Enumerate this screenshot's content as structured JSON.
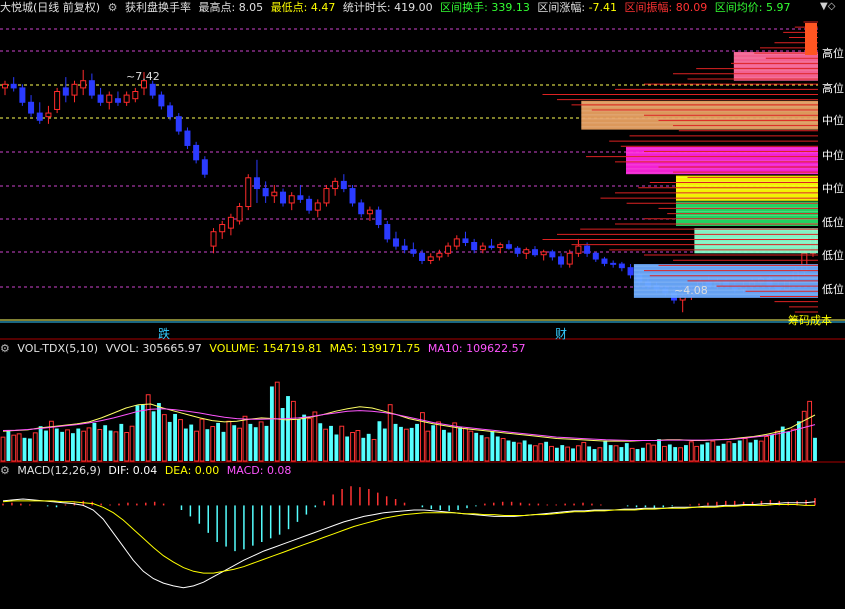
{
  "main_header": {
    "stock": "大悦城(日线 前复权)",
    "indicator": "获利盘换手率",
    "high_label": "最高点:",
    "high_value": "8.05",
    "low_label": "最低点:",
    "low_value": "4.47",
    "span_label": "统计时长:",
    "span_value": "419.00",
    "turnover_label": "区间换手:",
    "turnover_value": "339.13",
    "change_label": "区间涨幅:",
    "change_value": "-7.41",
    "amp_label": "区间振幅:",
    "amp_value": "80.09",
    "avg_label": "区间均价:",
    "avg_value": "5.97"
  },
  "vol_header": {
    "name": "VOL-TDX(5,10)",
    "vvol": "VVOL: 305665.97",
    "volume": "VOLUME: 154719.81",
    "ma5": "MA5: 139171.75",
    "ma10": "MA10: 109622.57"
  },
  "macd_header": {
    "name": "MACD(12,26,9)",
    "dif": "DIF: 0.04",
    "dea": "DEA: 0.00",
    "macd": "MACD: 0.08"
  },
  "annotations": {
    "high_mark": "7.42",
    "low_mark": "4.08",
    "event_1": "跌",
    "event_2": "财",
    "bottom_right": "筹码成本"
  },
  "zone_labels": [
    "高位",
    "高位",
    "中位",
    "中位",
    "中位",
    "低位",
    "低位",
    "低位"
  ],
  "chart_data": [
    {
      "type": "candlestick",
      "title": "大悦城(日线 前复权)",
      "ylim": [
        4.0,
        8.2
      ],
      "annotated_high": 7.42,
      "annotated_low": 4.08,
      "candles": [
        [
          7.2,
          7.3,
          7.1,
          7.25
        ],
        [
          7.25,
          7.35,
          7.15,
          7.2
        ],
        [
          7.2,
          7.25,
          6.95,
          7.0
        ],
        [
          7.0,
          7.1,
          6.8,
          6.85
        ],
        [
          6.85,
          7.0,
          6.7,
          6.75
        ],
        [
          6.8,
          6.95,
          6.7,
          6.85
        ],
        [
          6.9,
          7.2,
          6.85,
          7.15
        ],
        [
          7.2,
          7.35,
          7.0,
          7.1
        ],
        [
          7.1,
          7.3,
          7.0,
          7.25
        ],
        [
          7.2,
          7.45,
          7.1,
          7.3
        ],
        [
          7.3,
          7.4,
          7.05,
          7.1
        ],
        [
          7.1,
          7.2,
          6.95,
          7.0
        ],
        [
          7.0,
          7.15,
          6.9,
          7.1
        ],
        [
          7.05,
          7.15,
          6.95,
          7.0
        ],
        [
          7.0,
          7.15,
          6.95,
          7.1
        ],
        [
          7.05,
          7.2,
          7.0,
          7.15
        ],
        [
          7.2,
          7.42,
          7.1,
          7.3
        ],
        [
          7.25,
          7.3,
          7.05,
          7.1
        ],
        [
          7.1,
          7.15,
          6.9,
          6.95
        ],
        [
          6.95,
          7.0,
          6.75,
          6.8
        ],
        [
          6.8,
          6.85,
          6.55,
          6.6
        ],
        [
          6.6,
          6.65,
          6.35,
          6.4
        ],
        [
          6.4,
          6.45,
          6.15,
          6.2
        ],
        [
          6.2,
          6.25,
          5.95,
          6.0
        ],
        [
          5.0,
          5.25,
          4.9,
          5.2
        ],
        [
          5.2,
          5.35,
          5.1,
          5.3
        ],
        [
          5.25,
          5.45,
          5.15,
          5.4
        ],
        [
          5.35,
          5.6,
          5.3,
          5.55
        ],
        [
          5.55,
          6.0,
          5.5,
          5.95
        ],
        [
          5.95,
          6.2,
          5.6,
          5.8
        ],
        [
          5.8,
          5.9,
          5.6,
          5.7
        ],
        [
          5.7,
          5.85,
          5.6,
          5.75
        ],
        [
          5.75,
          5.8,
          5.55,
          5.6
        ],
        [
          5.6,
          5.75,
          5.5,
          5.7
        ],
        [
          5.7,
          5.85,
          5.6,
          5.65
        ],
        [
          5.65,
          5.7,
          5.45,
          5.5
        ],
        [
          5.5,
          5.65,
          5.4,
          5.6
        ],
        [
          5.6,
          5.85,
          5.55,
          5.8
        ],
        [
          5.8,
          5.95,
          5.7,
          5.9
        ],
        [
          5.9,
          6.0,
          5.75,
          5.8
        ],
        [
          5.8,
          5.85,
          5.55,
          5.6
        ],
        [
          5.6,
          5.65,
          5.4,
          5.45
        ],
        [
          5.45,
          5.55,
          5.35,
          5.5
        ],
        [
          5.5,
          5.55,
          5.25,
          5.3
        ],
        [
          5.3,
          5.35,
          5.05,
          5.1
        ],
        [
          5.1,
          5.2,
          4.95,
          5.0
        ],
        [
          5.0,
          5.1,
          4.9,
          4.95
        ],
        [
          4.95,
          5.05,
          4.85,
          4.9
        ],
        [
          4.9,
          4.95,
          4.75,
          4.8
        ],
        [
          4.8,
          4.9,
          4.75,
          4.85
        ],
        [
          4.85,
          4.95,
          4.8,
          4.9
        ],
        [
          4.9,
          5.05,
          4.85,
          5.0
        ],
        [
          5.0,
          5.15,
          4.95,
          5.1
        ],
        [
          5.1,
          5.2,
          5.0,
          5.05
        ],
        [
          5.05,
          5.1,
          4.9,
          4.95
        ],
        [
          4.95,
          5.05,
          4.9,
          5.0
        ],
        [
          5.0,
          5.1,
          4.95,
          4.98
        ],
        [
          4.98,
          5.05,
          4.9,
          5.02
        ],
        [
          5.02,
          5.08,
          4.95,
          4.97
        ],
        [
          4.97,
          5.0,
          4.85,
          4.9
        ],
        [
          4.9,
          4.98,
          4.82,
          4.95
        ],
        [
          4.95,
          5.0,
          4.85,
          4.88
        ],
        [
          4.88,
          4.95,
          4.8,
          4.92
        ],
        [
          4.92,
          4.95,
          4.8,
          4.85
        ],
        [
          4.85,
          4.9,
          4.7,
          4.75
        ],
        [
          4.75,
          4.95,
          4.7,
          4.9
        ],
        [
          4.9,
          5.1,
          4.85,
          5.0
        ],
        [
          5.0,
          5.05,
          4.85,
          4.9
        ],
        [
          4.9,
          4.92,
          4.78,
          4.82
        ],
        [
          4.82,
          4.85,
          4.72,
          4.76
        ],
        [
          4.76,
          4.8,
          4.7,
          4.75
        ],
        [
          4.75,
          4.78,
          4.65,
          4.7
        ],
        [
          4.7,
          4.75,
          4.55,
          4.6
        ],
        [
          4.6,
          4.65,
          4.45,
          4.5
        ],
        [
          4.5,
          4.55,
          4.4,
          4.45
        ],
        [
          4.45,
          4.5,
          4.35,
          4.4
        ],
        [
          4.4,
          4.45,
          4.3,
          4.35
        ],
        [
          4.35,
          4.4,
          4.2,
          4.25
        ],
        [
          4.25,
          4.35,
          4.08,
          4.3
        ],
        [
          4.3,
          4.45,
          4.25,
          4.4
        ],
        [
          4.4,
          4.55,
          4.35,
          4.5
        ],
        [
          4.5,
          4.6,
          4.4,
          4.45
        ],
        [
          4.45,
          4.55,
          4.4,
          4.5
        ],
        [
          4.5,
          4.55,
          4.4,
          4.45
        ],
        [
          4.45,
          4.5,
          4.35,
          4.4
        ],
        [
          4.4,
          4.5,
          4.35,
          4.45
        ],
        [
          4.45,
          4.55,
          4.4,
          4.5
        ],
        [
          4.5,
          4.6,
          4.45,
          4.55
        ],
        [
          4.55,
          4.6,
          4.4,
          4.45
        ],
        [
          4.45,
          4.5,
          4.35,
          4.4
        ],
        [
          4.4,
          4.55,
          4.38,
          4.52
        ],
        [
          4.52,
          4.7,
          4.5,
          4.65
        ],
        [
          4.65,
          4.95,
          4.6,
          4.9
        ],
        [
          4.9,
          5.25,
          4.85,
          5.15
        ]
      ]
    },
    {
      "type": "bar",
      "title": "VOL-TDX(5,10)",
      "ylim": [
        0,
        320000
      ],
      "volumes": [
        72000,
        90000,
        78000,
        82000,
        70000,
        68000,
        85000,
        105000,
        92000,
        120000,
        98000,
        88000,
        94000,
        84000,
        98000,
        90000,
        100000,
        115000,
        95000,
        108000,
        92000,
        88000,
        112000,
        86000,
        105000,
        168000,
        170000,
        200000,
        150000,
        175000,
        140000,
        118000,
        142000,
        125000,
        98000,
        110000,
        90000,
        126000,
        96000,
        104000,
        115000,
        88000,
        120000,
        108000,
        99000,
        135000,
        112000,
        102000,
        118000,
        106000,
        225000,
        238000,
        160000,
        196000,
        180000,
        126000,
        140000,
        128000,
        148000,
        114000,
        96000,
        106000,
        80000,
        105000,
        74000,
        86000,
        92000,
        70000,
        82000,
        65000,
        120000,
        98000,
        170000,
        112000,
        103000,
        96000,
        100000,
        112000,
        146000,
        90000,
        108000,
        118000,
        94000,
        86000,
        115000,
        102000,
        98000,
        90000,
        85000,
        78000,
        70000,
        90000,
        74000,
        68000,
        62000,
        58000,
        54000,
        62000,
        50000,
        46000,
        52000,
        58000,
        44000,
        40000,
        48000,
        42000,
        38000,
        46000,
        56000,
        44000,
        36000,
        40000,
        62000,
        48000,
        46000,
        42000,
        54000,
        38000,
        36000,
        40000,
        52000,
        48000,
        66000,
        44000,
        50000,
        42000,
        40000,
        48000,
        58000,
        44000,
        50000,
        56000,
        60000,
        46000,
        52000,
        58000,
        54000,
        62000,
        68000,
        56000,
        64000,
        60000,
        74000,
        80000,
        90000,
        104000,
        88000,
        96000,
        120000,
        150000,
        180000,
        70000
      ],
      "ma5": [
        90000,
        92000,
        94000,
        100000,
        104000,
        108000,
        112000,
        118000,
        130000,
        145000,
        160000,
        170000,
        172000,
        160000,
        150000,
        140000,
        130000,
        122000,
        118000,
        120000,
        126000,
        130000,
        128000,
        124000,
        126000,
        132000,
        140000,
        150000,
        158000,
        164000,
        160000,
        150000,
        140000,
        128000,
        120000,
        112000,
        106000,
        100000,
        96000,
        92000,
        88000,
        84000,
        80000,
        76000,
        72000,
        68000,
        66000,
        64000,
        62000,
        60000,
        60000,
        60000,
        62000,
        62000,
        64000,
        64000,
        62000,
        62000,
        64000,
        66000,
        70000,
        74000,
        80000,
        88000,
        100000,
        120000,
        139000
      ],
      "ma10": [
        92000,
        93000,
        95000,
        98000,
        102000,
        106000,
        110000,
        115000,
        122000,
        130000,
        140000,
        150000,
        156000,
        158000,
        155000,
        150000,
        145000,
        138000,
        132000,
        128000,
        126000,
        126000,
        127000,
        128000,
        130000,
        134000,
        140000,
        145000,
        150000,
        152000,
        150000,
        146000,
        140000,
        132000,
        124000,
        116000,
        110000,
        104000,
        100000,
        96000,
        92000,
        88000,
        84000,
        80000,
        76000,
        72000,
        70000,
        68000,
        66000,
        64000,
        63000,
        62000,
        62000,
        62000,
        63000,
        63000,
        63000,
        63000,
        64000,
        65000,
        68000,
        72000,
        76000,
        82000,
        90000,
        100000,
        110000
      ]
    },
    {
      "type": "bar",
      "title": "MACD(12,26,9)",
      "ylim": [
        -1.1,
        0.3
      ],
      "macd": [
        0.02,
        0.03,
        0.02,
        0.01,
        0.0,
        -0.01,
        -0.02,
        0.01,
        0.03,
        0.05,
        0.04,
        0.02,
        0.01,
        0.02,
        0.03,
        0.02,
        0.03,
        0.04,
        0.02,
        0.0,
        -0.05,
        -0.12,
        -0.2,
        -0.3,
        -0.4,
        -0.45,
        -0.5,
        -0.48,
        -0.44,
        -0.4,
        -0.36,
        -0.32,
        -0.26,
        -0.18,
        -0.1,
        -0.02,
        0.05,
        0.12,
        0.18,
        0.21,
        0.2,
        0.18,
        0.14,
        0.1,
        0.07,
        0.03,
        0.0,
        -0.02,
        -0.04,
        -0.05,
        -0.06,
        -0.05,
        -0.03,
        -0.01,
        0.02,
        0.03,
        0.04,
        0.04,
        0.03,
        0.02,
        0.02,
        0.01,
        0.01,
        0.02,
        0.02,
        0.03,
        0.02,
        0.01,
        0.0,
        0.0,
        -0.01,
        -0.02,
        -0.02,
        -0.03,
        -0.02,
        -0.01,
        0.0,
        0.01,
        0.02,
        0.03,
        0.04,
        0.05,
        0.05,
        0.04,
        0.04,
        0.05,
        0.06,
        0.05,
        0.04,
        0.05,
        0.06,
        0.08
      ],
      "dif": [
        0.05,
        0.06,
        0.07,
        0.06,
        0.05,
        0.04,
        0.03,
        0.02,
        0.0,
        -0.05,
        -0.15,
        -0.3,
        -0.45,
        -0.6,
        -0.72,
        -0.8,
        -0.85,
        -0.88,
        -0.9,
        -0.88,
        -0.84,
        -0.78,
        -0.72,
        -0.66,
        -0.6,
        -0.55,
        -0.5,
        -0.46,
        -0.42,
        -0.38,
        -0.34,
        -0.3,
        -0.26,
        -0.22,
        -0.18,
        -0.15,
        -0.12,
        -0.1,
        -0.08,
        -0.07,
        -0.06,
        -0.05,
        -0.05,
        -0.06,
        -0.07,
        -0.08,
        -0.09,
        -0.1,
        -0.11,
        -0.12,
        -0.12,
        -0.12,
        -0.11,
        -0.1,
        -0.09,
        -0.08,
        -0.07,
        -0.06,
        -0.06,
        -0.05,
        -0.05,
        -0.05,
        -0.04,
        -0.04,
        -0.03,
        -0.03,
        -0.03,
        -0.02,
        -0.02,
        -0.02,
        -0.01,
        -0.01,
        0.0,
        0.0,
        0.01,
        0.01,
        0.02,
        0.02,
        0.03,
        0.03,
        0.03,
        0.04
      ],
      "dea": [
        0.04,
        0.05,
        0.05,
        0.05,
        0.05,
        0.05,
        0.04,
        0.04,
        0.03,
        0.02,
        -0.02,
        -0.08,
        -0.16,
        -0.26,
        -0.36,
        -0.46,
        -0.55,
        -0.62,
        -0.68,
        -0.72,
        -0.74,
        -0.74,
        -0.72,
        -0.7,
        -0.67,
        -0.63,
        -0.59,
        -0.55,
        -0.51,
        -0.47,
        -0.43,
        -0.39,
        -0.35,
        -0.31,
        -0.27,
        -0.23,
        -0.2,
        -0.17,
        -0.14,
        -0.12,
        -0.1,
        -0.09,
        -0.08,
        -0.08,
        -0.08,
        -0.08,
        -0.09,
        -0.09,
        -0.1,
        -0.1,
        -0.11,
        -0.11,
        -0.11,
        -0.1,
        -0.1,
        -0.09,
        -0.08,
        -0.07,
        -0.07,
        -0.06,
        -0.06,
        -0.05,
        -0.05,
        -0.05,
        -0.04,
        -0.04,
        -0.03,
        -0.03,
        -0.03,
        -0.02,
        -0.02,
        -0.02,
        -0.01,
        -0.01,
        0.0,
        0.0,
        0.0,
        0.01,
        0.01,
        0.01,
        0.0,
        0.0
      ]
    }
  ],
  "chip_profile": {
    "zones": [
      {
        "price_top": 7.7,
        "price_bottom": 7.3,
        "width": 0.32,
        "color": "#ff6699"
      },
      {
        "price_top": 7.02,
        "price_bottom": 6.62,
        "width": 0.9,
        "color": "#e8a060"
      },
      {
        "price_top": 6.38,
        "price_bottom": 6.0,
        "width": 0.73,
        "color": "#ff22dd"
      },
      {
        "price_top": 5.98,
        "price_bottom": 5.63,
        "width": 0.54,
        "color": "#ffff00"
      },
      {
        "price_top": 5.62,
        "price_bottom": 5.28,
        "width": 0.54,
        "color": "#22dd66"
      },
      {
        "price_top": 5.25,
        "price_bottom": 4.9,
        "width": 0.47,
        "color": "#88ffcc"
      },
      {
        "price_top": 4.75,
        "price_bottom": 4.28,
        "width": 0.7,
        "color": "#6aaaff"
      }
    ],
    "profile": [
      0.05,
      0.08,
      0.12,
      0.1,
      0.15,
      0.2,
      0.22,
      0.18,
      0.3,
      0.42,
      0.5,
      0.45,
      0.6,
      0.7,
      0.95,
      0.9,
      0.85,
      0.78,
      0.6,
      0.55,
      0.5,
      0.48,
      0.65,
      0.72,
      0.68,
      0.6,
      0.8,
      0.7,
      0.55,
      0.5,
      0.45,
      0.58,
      0.62,
      0.7,
      0.75,
      0.66,
      0.55,
      0.52,
      0.6,
      0.7,
      0.82,
      0.9,
      0.95,
      0.85,
      0.72,
      0.6,
      0.5,
      0.55,
      0.6,
      0.58,
      0.45,
      0.35,
      0.25,
      0.2,
      0.15,
      0.1,
      0.08
    ]
  }
}
